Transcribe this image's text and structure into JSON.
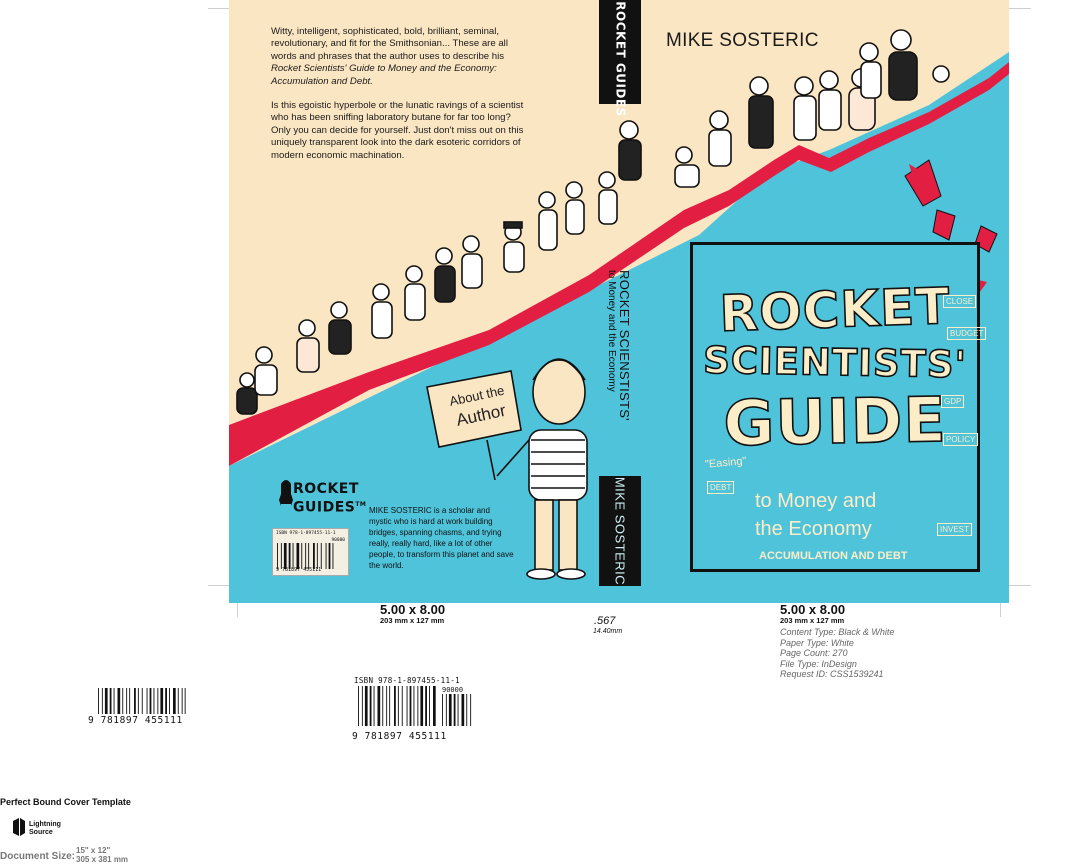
{
  "colors": {
    "cream": "#fbe6c3",
    "cyan": "#4fc3da",
    "red": "#e21e43",
    "black": "#111111"
  },
  "back_cover": {
    "blurb_p1": "Witty, intelligent, sophisticated, bold, brilliant, seminal, revolutionary, and fit for the Smithsonian... These are all words and phrases that the author uses to describe his ",
    "blurb_p1_italic": "Rocket Scientists' Guide to Money and the Economy: Accumulation and Debt.",
    "blurb_p2": "Is this egoistic hyperbole or the lunatic ravings of a scientist who has been sniffing laboratory butane for far too long? Only you can decide for yourself. Just don't miss out on this uniquely transparent look into the dark esoteric corridors of modern economic machination.",
    "sign_line1": "About the",
    "sign_line2": "Author",
    "logo_text_1": "ROCKET",
    "logo_text_2": "GUIDES",
    "logo_tm": "TM",
    "barcode_isbn": "ISBN 978-1-897455-11-1",
    "barcode_price": "90000",
    "barcode_digits": "9 781897 455111",
    "author_bio": "MIKE SOSTERIC is a scholar and mystic who is hard at work building bridges, spanning chasms, and trying really, really hard, like a lot of other people, to transform this planet and save the world."
  },
  "spine": {
    "logo": "ROCKET GUIDES",
    "title_line1": "ROCKET SCIENSTISTS'",
    "title_line2": "to Money and the Economy",
    "author": "MIKE SOSTERIC"
  },
  "front_cover": {
    "author": "MIKE SOSTERIC",
    "title_1": "ROCKET",
    "title_2": "SCIENTISTS'",
    "title_3": "GUIDE",
    "subtitle_1": "to Money and",
    "subtitle_2": "the Economy",
    "subtitle_3": "ACCUMULATION AND DEBT",
    "easing": "\"Easing\"",
    "doodles": [
      "GDP",
      "POLICY",
      "INVEST",
      "CLOSE",
      "BUDGET",
      "DEBT"
    ]
  },
  "template": {
    "back_size": "5.00 x 8.00",
    "back_mm": "203 mm x 127 mm",
    "spine_width": ".567",
    "spine_mm": "14.40mm",
    "front_size": "5.00 x 8.00",
    "front_mm": "203 mm x 127 mm",
    "content_type": "Content Type: Black & White",
    "paper_type": "Paper Type: White",
    "page_count": "Page Count: 270",
    "file_type": "File Type: InDesign",
    "request_id": "Request ID: CSS1539241",
    "barcode1_digits": "9 781897 455111",
    "barcode2_isbn": "ISBN 978-1-897455-11-1",
    "barcode2_price": "90000",
    "barcode2_digits": "9 781897 455111",
    "template_title": "Perfect Bound Cover Template",
    "ls_logo_1": "Lightning",
    "ls_logo_2": "Source",
    "doc_size_label": "Document Size:",
    "doc_size_in": "15\" x 12\"",
    "doc_size_mm": "305 x 381 mm"
  }
}
